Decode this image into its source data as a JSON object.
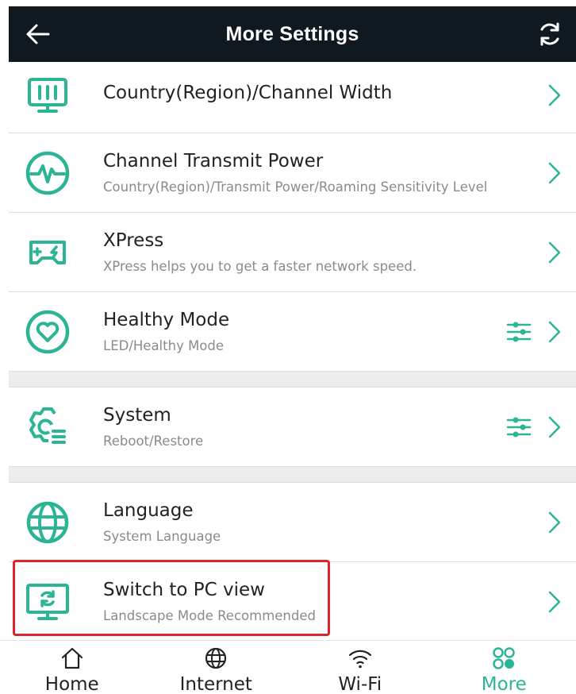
{
  "header": {
    "title": "More Settings"
  },
  "colors": {
    "accent": "#2bb594",
    "header_bg": "#101820",
    "highlight": "#e0242b"
  },
  "rows": [
    {
      "label": "Country(Region)/Channel Width",
      "sub": "",
      "icon": "monitor-chart-icon"
    },
    {
      "label": "Channel Transmit Power",
      "sub": "Country(Region)/Transmit Power/Roaming Sensitivity Level",
      "icon": "signal-pulse-icon"
    },
    {
      "label": "XPress",
      "sub": "XPress helps you to get a faster network speed.",
      "icon": "gamepad-icon"
    },
    {
      "label": "Healthy Mode",
      "sub": "LED/Healthy Mode",
      "icon": "heart-icon"
    },
    {
      "label": "System",
      "sub": "Reboot/Restore",
      "icon": "system-gear-icon"
    },
    {
      "label": "Language",
      "sub": "System Language",
      "icon": "globe-icon"
    },
    {
      "label": "Switch to PC view",
      "sub": "Landscape Mode Recommended",
      "icon": "pc-view-icon"
    }
  ],
  "tabs": [
    {
      "label": "Home",
      "icon": "home-icon",
      "active": false
    },
    {
      "label": "Internet",
      "icon": "globe-icon",
      "active": false
    },
    {
      "label": "Wi-Fi",
      "icon": "wifi-icon",
      "active": false
    },
    {
      "label": "More",
      "icon": "more-grid-icon",
      "active": true
    }
  ]
}
